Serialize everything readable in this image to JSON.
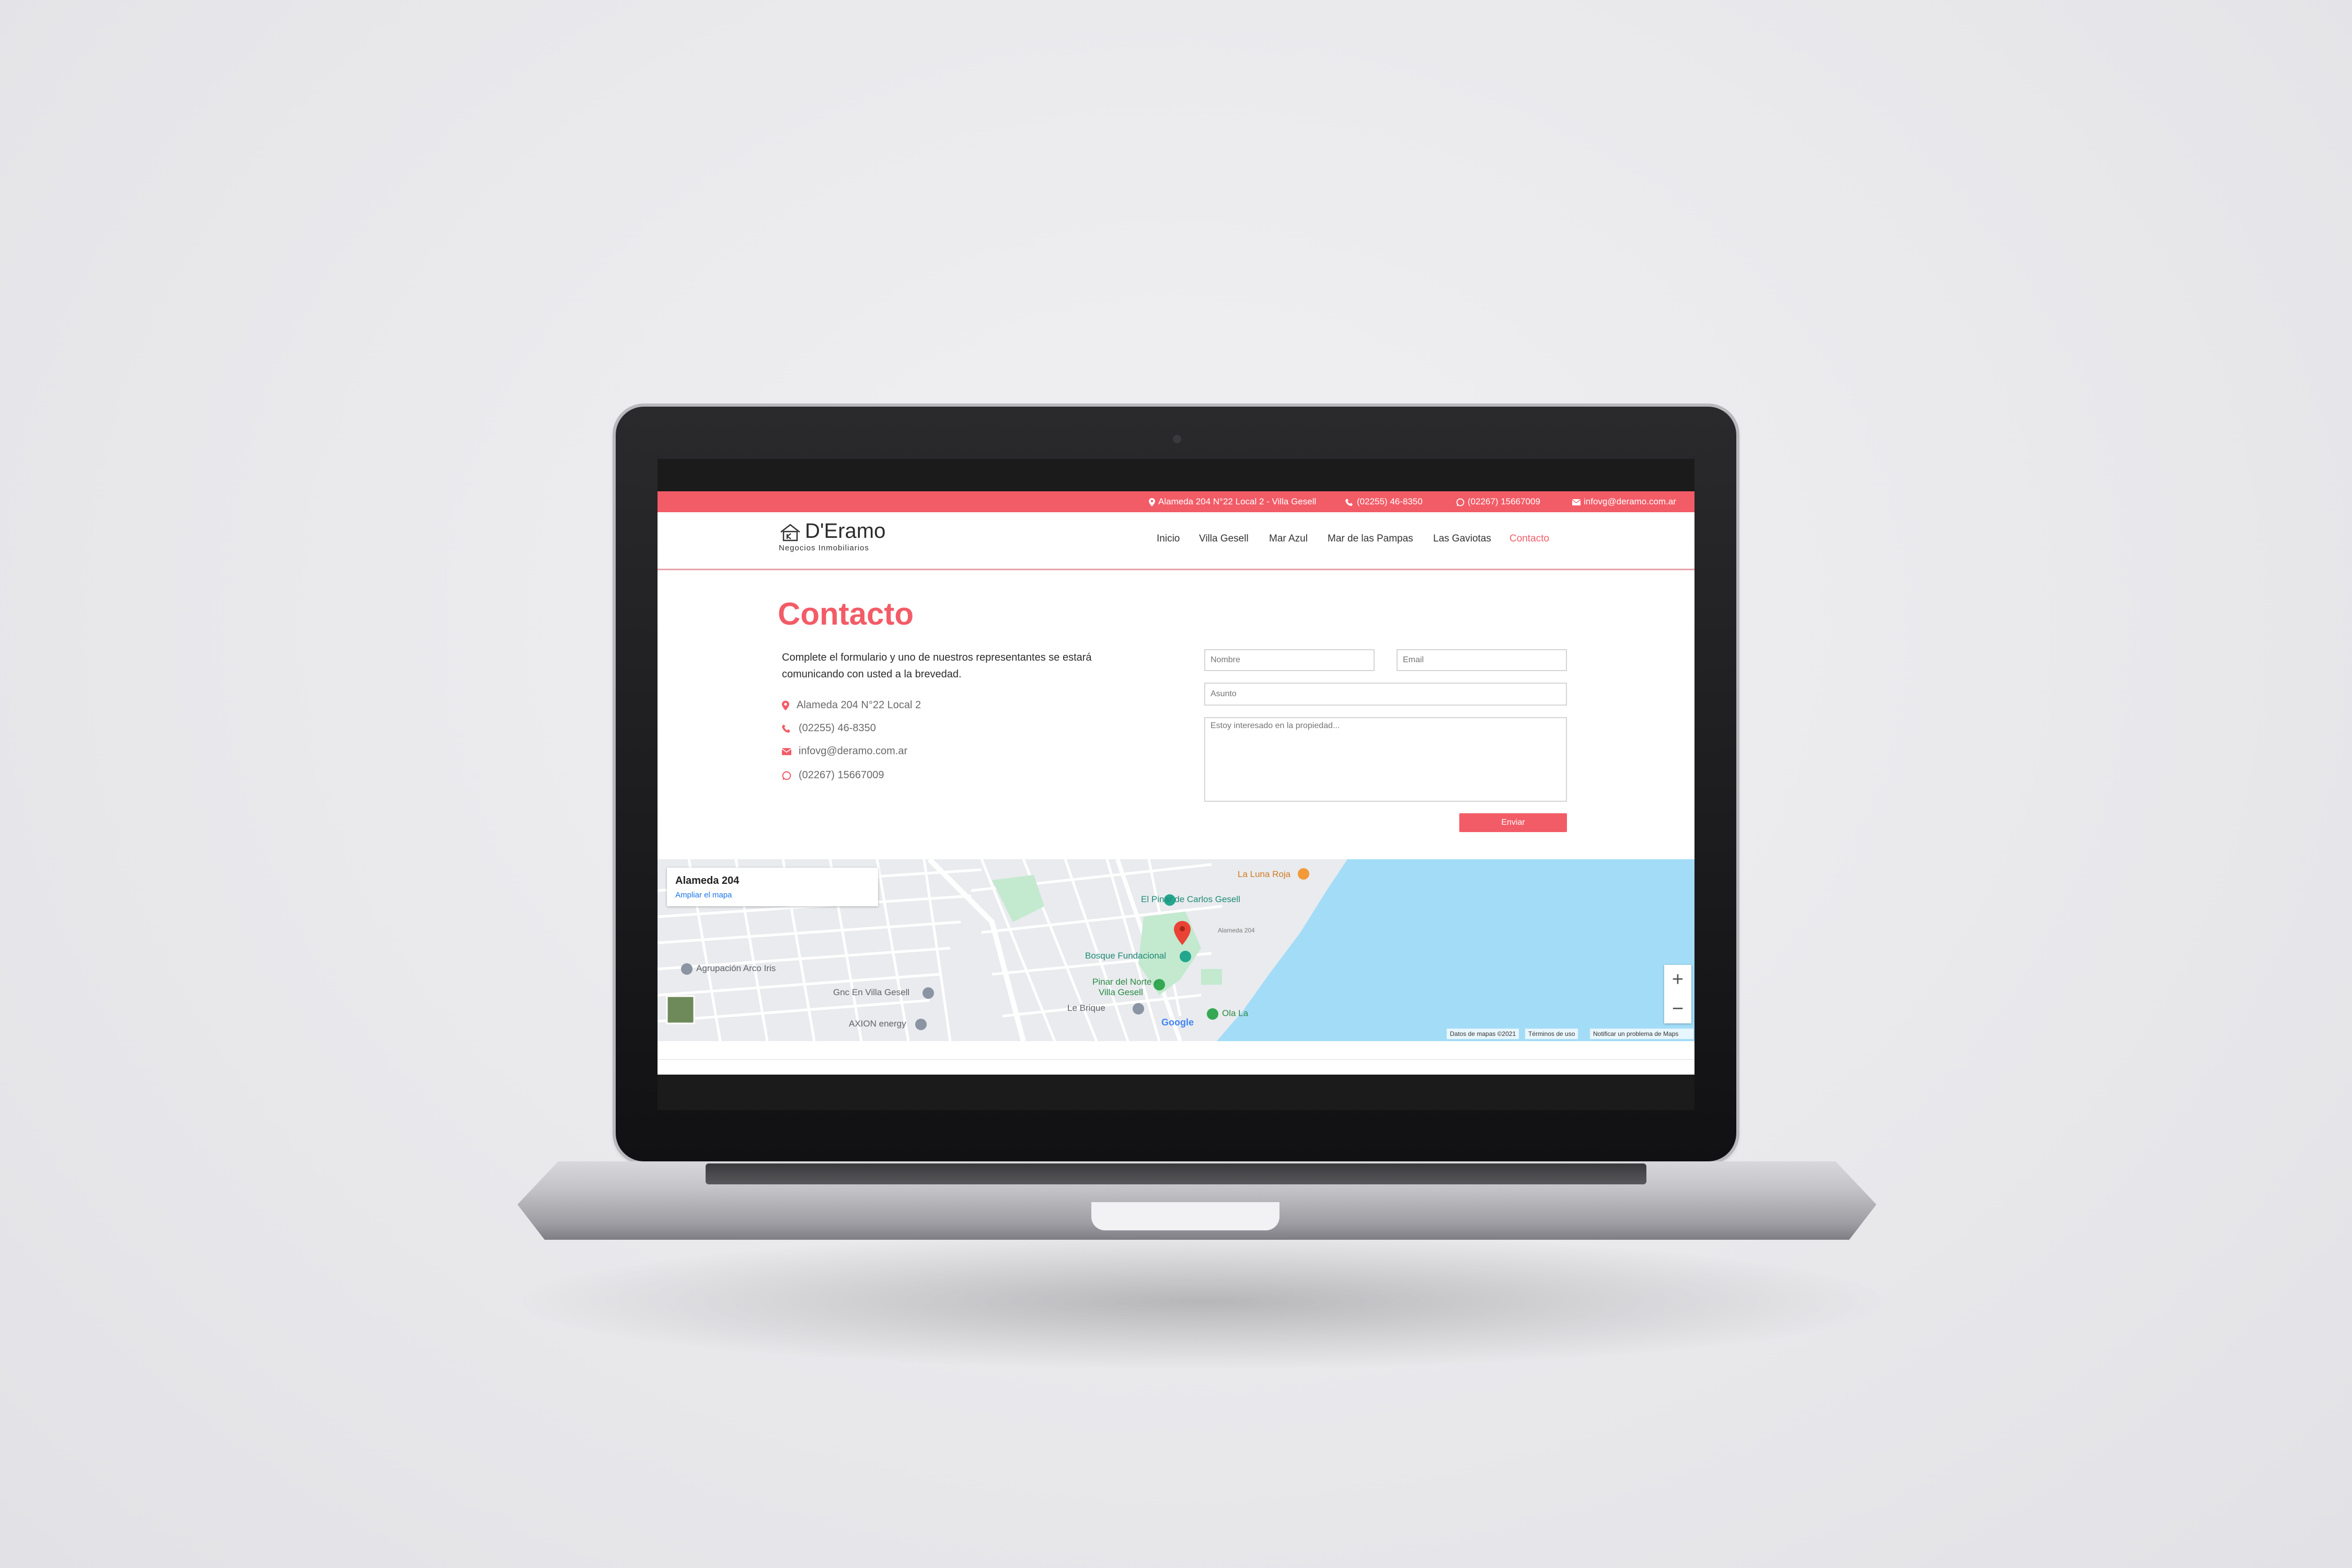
{
  "topbar": {
    "address": "Alameda 204 N°22 Local 2 - Villa Gesell",
    "phone": "(02255) 46-8350",
    "whatsapp": "(02267) 15667009",
    "email": "infovg@deramo.com.ar"
  },
  "brand": {
    "name": "D'Eramo",
    "tagline": "Negocios Inmobiliarios"
  },
  "nav": {
    "items": [
      "Inicio",
      "Villa Gesell",
      "Mar Azul",
      "Mar de las Pampas",
      "Las Gaviotas",
      "Contacto"
    ],
    "active": "Contacto"
  },
  "contact": {
    "title": "Contacto",
    "intro": "Complete el formulario y uno de nuestros representantes se estará comunicando con usted a la brevedad.",
    "address": "Alameda 204 N°22 Local 2",
    "phone": "(02255) 46-8350",
    "email": "infovg@deramo.com.ar",
    "whatsapp": "(02267) 15667009"
  },
  "form": {
    "name_placeholder": "Nombre",
    "email_placeholder": "Email",
    "subject_placeholder": "Asunto",
    "message_placeholder": "Estoy interesado en la propiedad...",
    "submit_label": "Enviar"
  },
  "map": {
    "card_title": "Alameda 204",
    "card_link": "Ampliar el mapa",
    "labels": {
      "luna_roja": "La Luna Roja",
      "pinar": "El Pinar de Carlos Gesell",
      "bosque": "Bosque Fundacional",
      "pinar_norte_1": "Pinar del Norte -",
      "pinar_norte_2": "Villa Gesell",
      "brique": "Le Brique",
      "ola": "Ola La",
      "arco_iris": "Agrupación Arco Iris",
      "gnc": "Gnc En Villa Gesell",
      "axion": "AXION energy",
      "google": "Google",
      "street_alameda": "Alameda 204"
    },
    "zoom_in": "+",
    "zoom_out": "−",
    "footer": {
      "data": "Datos de mapas ©2021",
      "terms": "Términos de uso",
      "report": "Notificar un problema de Maps"
    }
  },
  "colors": {
    "accent": "#f25c67",
    "water": "#a3dcf7",
    "park": "#c3e9cf",
    "road": "#ffffff"
  }
}
